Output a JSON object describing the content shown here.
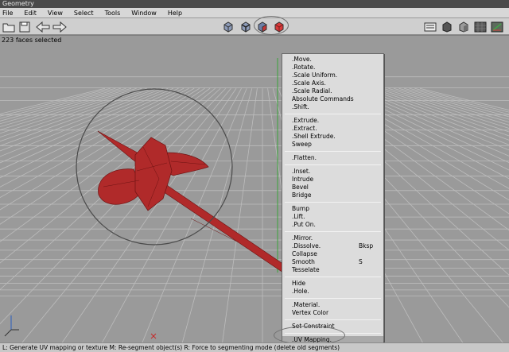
{
  "window": {
    "title": "Geometry"
  },
  "menubar": [
    "File",
    "Edit",
    "View",
    "Select",
    "Tools",
    "Window",
    "Help"
  ],
  "toolbar": {
    "left_icons": [
      "open-folder-icon",
      "save-icon",
      "undo-arrow-icon",
      "redo-arrow-icon"
    ],
    "select_modes": [
      "vertex-select-icon",
      "edge-select-icon",
      "face-select-icon",
      "object-select-icon"
    ],
    "right_icons": [
      "camera-view-icon",
      "wireframe-cube-icon",
      "shaded-cube-icon",
      "ground-plane-icon",
      "axes-icon"
    ],
    "active_mode": "face-select-icon"
  },
  "viewport": {
    "status_message": "223 faces selected",
    "axis_labels": {
      "x": "X",
      "y": "Y"
    },
    "colors": {
      "selection": "#b02a2a",
      "grid": "#bdbdbd",
      "background": "#9a9a9a"
    }
  },
  "context_menu": {
    "groups": [
      [
        {
          "label": ".Move."
        },
        {
          "label": ".Rotate."
        },
        {
          "label": ".Scale Uniform."
        },
        {
          "label": ".Scale Axis."
        },
        {
          "label": ".Scale Radial."
        },
        {
          "label": "Absolute Commands"
        },
        {
          "label": ".Shift."
        }
      ],
      [
        {
          "label": ".Extrude."
        },
        {
          "label": ".Extract."
        },
        {
          "label": ".Shell Extrude."
        },
        {
          "label": "Sweep"
        }
      ],
      [
        {
          "label": ".Flatten."
        }
      ],
      [
        {
          "label": ".Inset."
        },
        {
          "label": "Intrude"
        },
        {
          "label": "Bevel"
        },
        {
          "label": "Bridge"
        }
      ],
      [
        {
          "label": "Bump"
        },
        {
          "label": ".Lift."
        },
        {
          "label": ".Put On."
        }
      ],
      [
        {
          "label": ".Mirror."
        },
        {
          "label": ".Dissolve.",
          "shortcut": "Bksp"
        },
        {
          "label": "Collapse"
        },
        {
          "label": "Smooth",
          "shortcut": "S"
        },
        {
          "label": "Tesselate"
        }
      ],
      [
        {
          "label": "Hide"
        },
        {
          "label": ".Hole."
        }
      ],
      [
        {
          "label": ".Material."
        },
        {
          "label": "Vertex Color"
        }
      ],
      [
        {
          "label": "Set Constraint"
        }
      ],
      [
        {
          "label": ".UV Mapping.",
          "highlighted": true
        }
      ]
    ]
  },
  "statusbar": {
    "text": "L: Generate UV mapping or texture   M: Re-segment object(s)   R: Force to segmenting mode (delete old segments)"
  }
}
